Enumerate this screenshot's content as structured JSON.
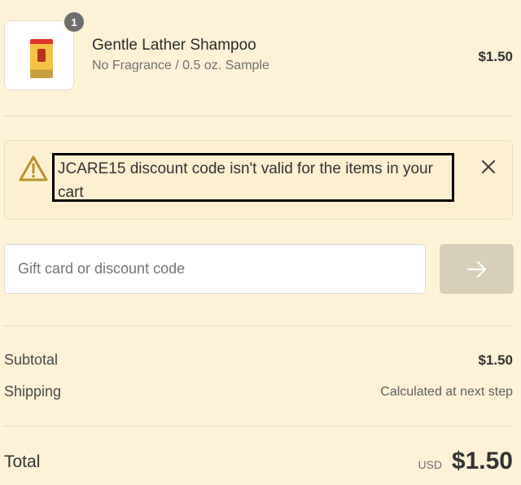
{
  "cart_item": {
    "quantity_badge": "1",
    "name": "Gentle Lather Shampoo",
    "variant": "No Fragrance / 0.5 oz. Sample",
    "price": "$1.50",
    "image_alt": "product-thumbnail"
  },
  "alert": {
    "message": "JCARE15 discount code isn't valid for the items in your cart",
    "icon": "warning-icon",
    "dismiss_icon": "close-icon"
  },
  "discount": {
    "placeholder": "Gift card or discount code",
    "value": "",
    "apply_icon": "arrow-right-icon"
  },
  "summary": {
    "subtotal_label": "Subtotal",
    "subtotal_value": "$1.50",
    "shipping_label": "Shipping",
    "shipping_value": "Calculated at next step",
    "total_label": "Total",
    "currency": "USD",
    "total_value": "$1.50"
  },
  "colors": {
    "background": "#fdf2d6",
    "apply_button": "#d8cfb8",
    "warning_stroke": "#b8932a"
  }
}
